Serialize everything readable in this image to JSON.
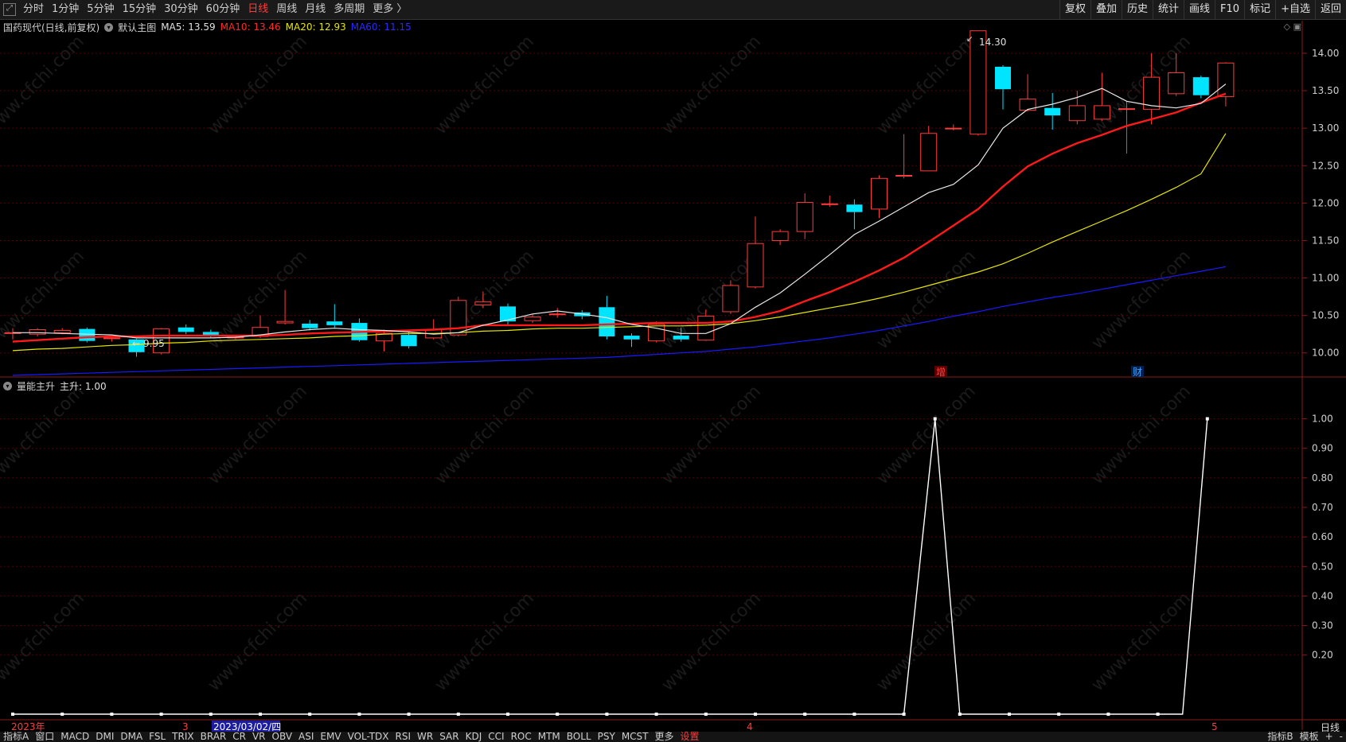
{
  "toolbar": {
    "timeframes": [
      "分时",
      "1分钟",
      "5分钟",
      "15分钟",
      "30分钟",
      "60分钟",
      "日线",
      "周线",
      "月线",
      "多周期",
      "更多 〉"
    ],
    "active_timeframe": "日线",
    "right_buttons": [
      "复权",
      "叠加",
      "历史",
      "统计",
      "画线",
      "F10",
      "标记",
      "+自选",
      "返回"
    ]
  },
  "main_chart": {
    "stock_title": "国药现代(日线,前复权)",
    "template": "默认主图",
    "ma5": "MA5: 13.59",
    "ma10": "MA10: 13.46",
    "ma20": "MA20: 12.93",
    "ma60": "MA60: 11.15",
    "colors": {
      "ma5": "#e8e8e8",
      "ma10": "#ff2020",
      "ma20": "#e6e600",
      "ma60": "#2020ff",
      "up": "#ff3b3b",
      "down": "#00e5ff"
    },
    "price_labels": [
      "14.00",
      "13.50",
      "13.00",
      "12.50",
      "12.00",
      "11.50",
      "11.00",
      "10.50",
      "10.00"
    ],
    "high_label": "14.30",
    "low_label": "9.95",
    "markers": [
      "增",
      "财"
    ]
  },
  "sub_chart": {
    "indicator": "量能主升",
    "value": "主升: 1.00",
    "labels": [
      "1.00",
      "0.90",
      "0.80",
      "0.70",
      "0.60",
      "0.50",
      "0.40",
      "0.30",
      "0.20"
    ]
  },
  "time_axis": {
    "year_label": "2023年",
    "month3": "3",
    "cursor_date": "2023/03/02/四",
    "month4": "4",
    "month5": "5",
    "period": "日线"
  },
  "watermark": "www.cfchi.com",
  "bottom_tabs": [
    "指标A",
    "窗口",
    "MACD",
    "DMI",
    "DMA",
    "FSL",
    "TRIX",
    "BRAR",
    "CR",
    "VR",
    "OBV",
    "ASI",
    "EMV",
    "VOL-TDX",
    "RSI",
    "WR",
    "SAR",
    "KDJ",
    "CCI",
    "ROC",
    "MTM",
    "BOLL",
    "PSY",
    "MCST",
    "更多",
    "设置"
  ],
  "bottom_right": [
    "指标B",
    "模板",
    "+",
    "-"
  ],
  "chart_data": {
    "type": "candlestick",
    "ylim": [
      9.7,
      14.35
    ],
    "candles": [
      {
        "o": 10.27,
        "c": 10.27,
        "h": 10.33,
        "l": 10.18
      },
      {
        "o": 10.25,
        "c": 10.31,
        "h": 10.33,
        "l": 10.22
      },
      {
        "o": 10.27,
        "c": 10.3,
        "h": 10.33,
        "l": 10.25
      },
      {
        "o": 10.32,
        "c": 10.16,
        "h": 10.34,
        "l": 10.14
      },
      {
        "o": 10.2,
        "c": 10.2,
        "h": 10.22,
        "l": 10.15
      },
      {
        "o": 10.18,
        "c": 10.01,
        "h": 10.19,
        "l": 9.95
      },
      {
        "o": 10.0,
        "c": 10.32,
        "h": 10.33,
        "l": 9.98
      },
      {
        "o": 10.34,
        "c": 10.28,
        "h": 10.38,
        "l": 10.25
      },
      {
        "o": 10.28,
        "c": 10.23,
        "h": 10.31,
        "l": 10.2
      },
      {
        "o": 10.21,
        "c": 10.21,
        "h": 10.24,
        "l": 10.18
      },
      {
        "o": 10.22,
        "c": 10.34,
        "h": 10.5,
        "l": 10.2
      },
      {
        "o": 10.4,
        "c": 10.42,
        "h": 10.84,
        "l": 10.38
      },
      {
        "o": 10.39,
        "c": 10.33,
        "h": 10.44,
        "l": 10.3
      },
      {
        "o": 10.42,
        "c": 10.37,
        "h": 10.65,
        "l": 10.34
      },
      {
        "o": 10.4,
        "c": 10.17,
        "h": 10.46,
        "l": 10.15
      },
      {
        "o": 10.16,
        "c": 10.26,
        "h": 10.31,
        "l": 10.02
      },
      {
        "o": 10.24,
        "c": 10.09,
        "h": 10.28,
        "l": 10.06
      },
      {
        "o": 10.2,
        "c": 10.31,
        "h": 10.45,
        "l": 10.18
      },
      {
        "o": 10.24,
        "c": 10.7,
        "h": 10.75,
        "l": 10.22
      },
      {
        "o": 10.64,
        "c": 10.68,
        "h": 10.82,
        "l": 10.6
      },
      {
        "o": 10.62,
        "c": 10.42,
        "h": 10.66,
        "l": 10.38
      },
      {
        "o": 10.43,
        "c": 10.48,
        "h": 10.52,
        "l": 10.4
      },
      {
        "o": 10.52,
        "c": 10.52,
        "h": 10.6,
        "l": 10.47
      },
      {
        "o": 10.54,
        "c": 10.49,
        "h": 10.57,
        "l": 10.45
      },
      {
        "o": 10.61,
        "c": 10.22,
        "h": 10.76,
        "l": 10.18
      },
      {
        "o": 10.23,
        "c": 10.18,
        "h": 10.26,
        "l": 10.08
      },
      {
        "o": 10.16,
        "c": 10.38,
        "h": 10.42,
        "l": 10.14
      },
      {
        "o": 10.23,
        "c": 10.18,
        "h": 10.34,
        "l": 10.15
      },
      {
        "o": 10.17,
        "c": 10.49,
        "h": 10.58,
        "l": 10.16
      },
      {
        "o": 10.55,
        "c": 10.9,
        "h": 10.97,
        "l": 10.52
      },
      {
        "o": 10.88,
        "c": 11.46,
        "h": 11.82,
        "l": 10.86
      },
      {
        "o": 11.5,
        "c": 11.62,
        "h": 11.65,
        "l": 11.44
      },
      {
        "o": 11.62,
        "c": 12.01,
        "h": 12.13,
        "l": 11.52
      },
      {
        "o": 11.98,
        "c": 11.99,
        "h": 12.1,
        "l": 11.95
      },
      {
        "o": 11.98,
        "c": 11.88,
        "h": 12.05,
        "l": 11.65
      },
      {
        "o": 11.92,
        "c": 12.33,
        "h": 12.37,
        "l": 11.8
      },
      {
        "o": 12.37,
        "c": 12.37,
        "h": 12.92,
        "l": 12.33
      },
      {
        "o": 12.43,
        "c": 12.93,
        "h": 13.03,
        "l": 12.43
      },
      {
        "o": 12.99,
        "c": 13.0,
        "h": 13.05,
        "l": 12.97
      },
      {
        "o": 12.92,
        "c": 14.3,
        "h": 14.3,
        "l": 12.9
      },
      {
        "o": 13.82,
        "c": 13.52,
        "h": 13.84,
        "l": 13.25
      },
      {
        "o": 13.24,
        "c": 13.39,
        "h": 13.72,
        "l": 13.22
      },
      {
        "o": 13.27,
        "c": 13.17,
        "h": 13.47,
        "l": 12.98
      },
      {
        "o": 13.1,
        "c": 13.3,
        "h": 13.5,
        "l": 13.05
      },
      {
        "o": 13.12,
        "c": 13.3,
        "h": 13.74,
        "l": 13.1
      },
      {
        "o": 13.26,
        "c": 13.26,
        "h": 13.36,
        "l": 12.66
      },
      {
        "o": 13.25,
        "c": 13.68,
        "h": 14.0,
        "l": 13.05
      },
      {
        "o": 13.46,
        "c": 13.74,
        "h": 14.0,
        "l": 13.43
      },
      {
        "o": 13.68,
        "c": 13.44,
        "h": 13.7,
        "l": 13.4
      },
      {
        "o": 13.42,
        "c": 13.87,
        "h": 13.88,
        "l": 13.29
      }
    ],
    "ma5": [
      10.27,
      10.27,
      10.26,
      10.25,
      10.24,
      10.2,
      10.2,
      10.2,
      10.2,
      10.21,
      10.24,
      10.28,
      10.31,
      10.33,
      10.31,
      10.3,
      10.28,
      10.25,
      10.27,
      10.37,
      10.44,
      10.52,
      10.56,
      10.52,
      10.47,
      10.38,
      10.33,
      10.26,
      10.26,
      10.39,
      10.61,
      10.8,
      11.05,
      11.31,
      11.58,
      11.76,
      11.95,
      12.14,
      12.25,
      12.51,
      13.0,
      13.25,
      13.32,
      13.41,
      13.53,
      13.36,
      13.3,
      13.27,
      13.33,
      13.59
    ],
    "ma10": [
      10.15,
      10.17,
      10.19,
      10.21,
      10.22,
      10.22,
      10.23,
      10.23,
      10.23,
      10.23,
      10.23,
      10.24,
      10.26,
      10.27,
      10.28,
      10.29,
      10.3,
      10.31,
      10.33,
      10.37,
      10.37,
      10.37,
      10.37,
      10.37,
      10.38,
      10.39,
      10.4,
      10.4,
      10.4,
      10.42,
      10.48,
      10.56,
      10.69,
      10.81,
      10.95,
      11.1,
      11.27,
      11.48,
      11.7,
      11.92,
      12.22,
      12.49,
      12.66,
      12.8,
      12.91,
      13.03,
      13.12,
      13.21,
      13.34,
      13.46
    ],
    "ma20": [
      10.03,
      10.05,
      10.06,
      10.08,
      10.1,
      10.11,
      10.13,
      10.14,
      10.16,
      10.17,
      10.18,
      10.19,
      10.2,
      10.22,
      10.23,
      10.25,
      10.26,
      10.26,
      10.27,
      10.29,
      10.3,
      10.32,
      10.33,
      10.33,
      10.34,
      10.35,
      10.36,
      10.36,
      10.37,
      10.39,
      10.43,
      10.48,
      10.54,
      10.6,
      10.66,
      10.73,
      10.81,
      10.9,
      10.99,
      11.08,
      11.19,
      11.33,
      11.48,
      11.62,
      11.76,
      11.9,
      12.05,
      12.21,
      12.39,
      12.93
    ],
    "ma60": [
      9.7,
      9.71,
      9.72,
      9.73,
      9.74,
      9.75,
      9.76,
      9.77,
      9.78,
      9.79,
      9.8,
      9.81,
      9.82,
      9.83,
      9.84,
      9.85,
      9.86,
      9.87,
      9.88,
      9.89,
      9.9,
      9.91,
      9.92,
      9.93,
      9.94,
      9.96,
      9.98,
      10.0,
      10.02,
      10.05,
      10.08,
      10.12,
      10.16,
      10.2,
      10.25,
      10.3,
      10.36,
      10.42,
      10.49,
      10.55,
      10.62,
      10.68,
      10.74,
      10.79,
      10.85,
      10.91,
      10.97,
      11.03,
      11.09,
      11.15
    ],
    "sub_ylim": [
      0,
      1.05
    ],
    "sub_values": [
      0,
      0,
      0,
      0,
      0,
      0,
      0,
      0,
      0,
      0,
      0,
      0,
      0,
      0,
      0,
      0,
      0,
      0,
      0,
      0,
      0,
      0,
      0,
      0,
      0,
      0,
      0,
      0,
      0,
      0,
      0,
      0,
      0,
      0,
      0,
      0,
      0,
      1,
      0,
      0,
      0,
      0,
      0,
      0,
      0,
      0,
      0,
      0,
      1
    ]
  }
}
